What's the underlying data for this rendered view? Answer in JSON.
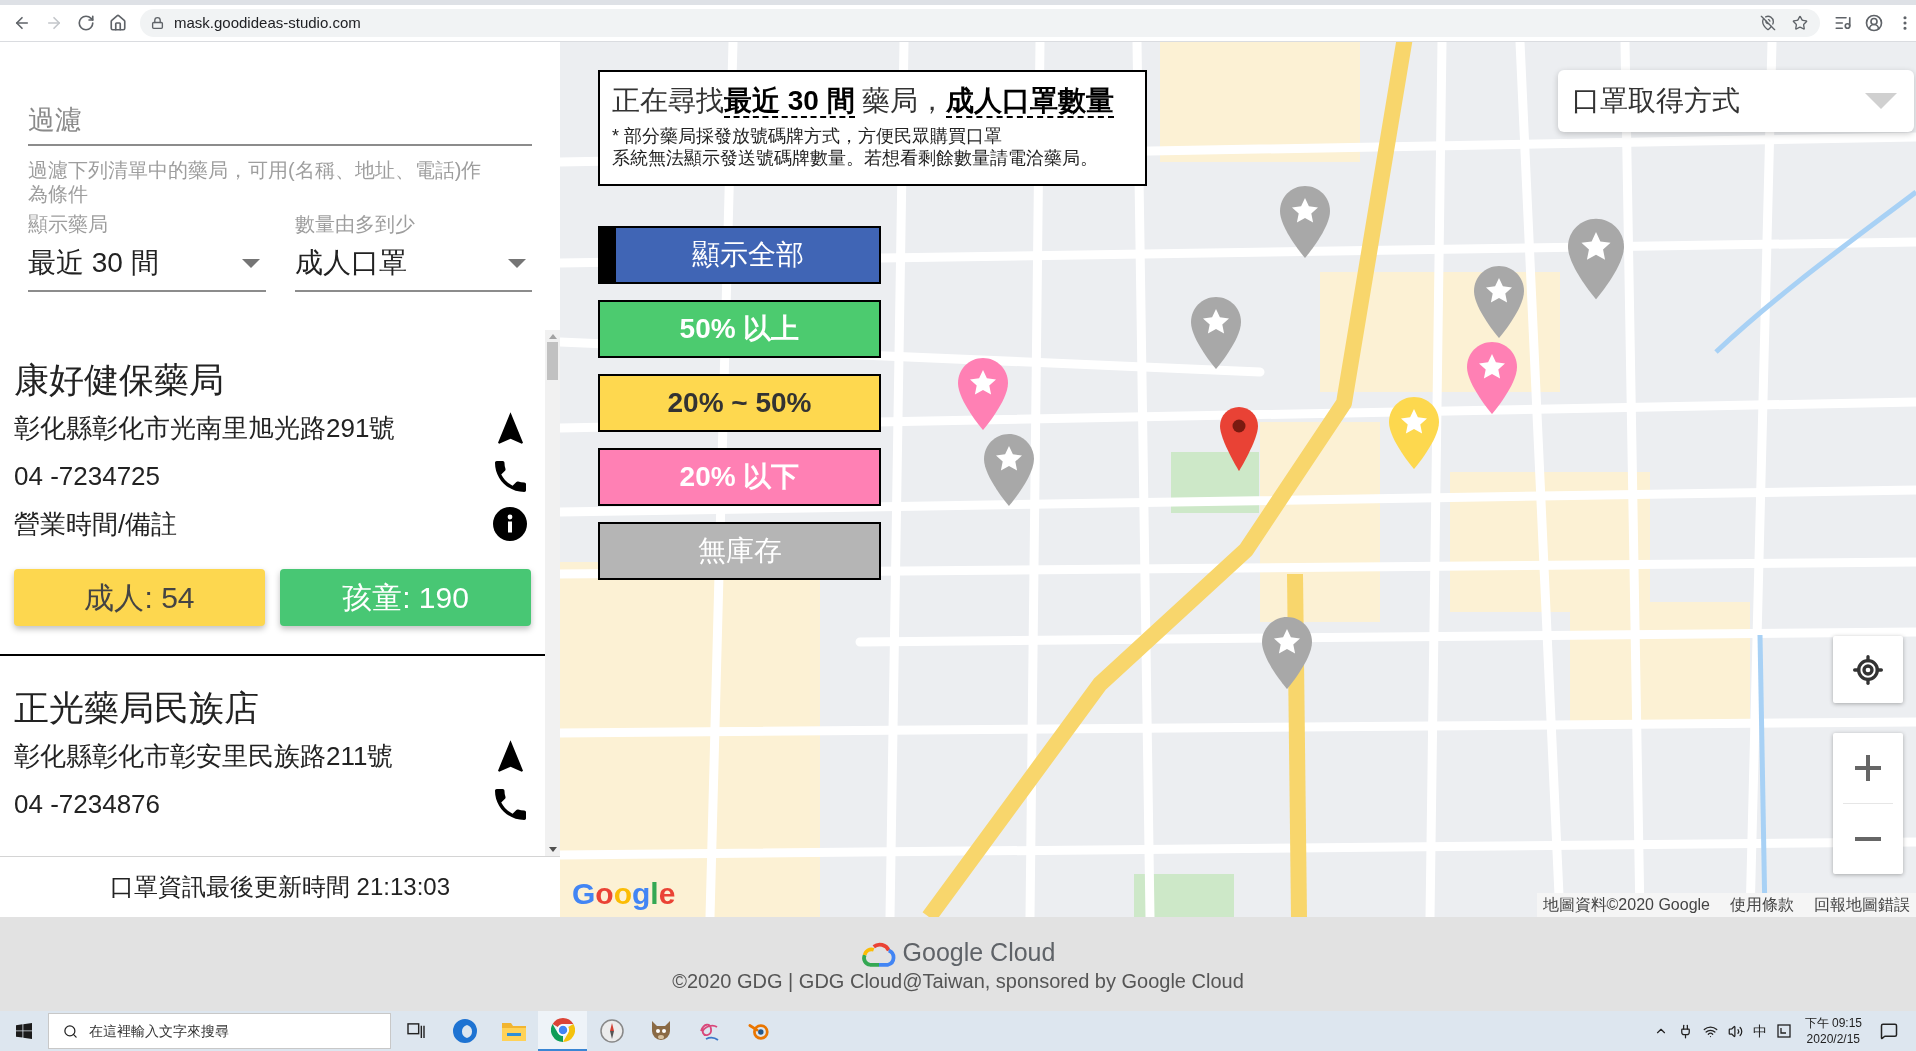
{
  "browser": {
    "nav": [
      {
        "kind": "back",
        "disabled": false
      },
      {
        "kind": "forward",
        "disabled": true
      },
      {
        "kind": "reload",
        "disabled": false
      },
      {
        "kind": "home",
        "disabled": false
      }
    ],
    "url": "mask.goodideas-studio.com",
    "omnibox_icons": [
      {
        "kind": "location-blocked"
      },
      {
        "kind": "bookmark"
      }
    ],
    "toolbar_icons": [
      {
        "kind": "media"
      },
      {
        "kind": "account"
      },
      {
        "kind": "menu"
      }
    ]
  },
  "sidebar": {
    "filter": {
      "placeholder": "過濾",
      "helper": "過濾下列清單中的藥局，可用(名稱、地址、電話)作為條件"
    },
    "selects": [
      {
        "label": "顯示藥局",
        "value": "最近 30 間"
      },
      {
        "label": "數量由多到少",
        "value": "成人口罩"
      }
    ],
    "pharmacies": [
      {
        "name": "康好健保藥局",
        "address": "彰化縣彰化市光南里旭光路291號",
        "phone": "04 -7234725",
        "note": "營業時間/備註",
        "stock": [
          {
            "label": "成人: 54",
            "color": "#fdd74f"
          },
          {
            "label": "孩童: 190",
            "color": "#48c774"
          }
        ]
      },
      {
        "name": "正光藥局民族店",
        "address": "彰化縣彰化市彰安里民族路211號",
        "phone": "04 -7234876"
      }
    ],
    "updated": "口罩資訊最後更新時間 21:13:03"
  },
  "map": {
    "summary": {
      "heading": [
        {
          "text": "正在尋找",
          "emphasis": false
        },
        {
          "text": "最近 30 間",
          "emphasis": true
        },
        {
          "text": " 藥局，",
          "emphasis": false
        },
        {
          "text": "成人口罩數量",
          "emphasis": true
        }
      ],
      "notes": [
        "* 部分藥局採發放號碼牌方式，方便民眾購買口罩",
        "系統無法顯示發送號碼牌數量。若想看剩餘數量請電洽藥局。"
      ]
    },
    "filters": [
      {
        "label": "顯示全部",
        "kind": "all",
        "color": "#4065b5",
        "selected": true
      },
      {
        "label": "50% 以上",
        "kind": "level",
        "color": "#4ccb6f",
        "selected": false
      },
      {
        "label": "20% ~ 50%",
        "kind": "level",
        "color": "#fed84f",
        "selected": false
      },
      {
        "label": "20% 以下",
        "kind": "level",
        "color": "#ff80b4",
        "selected": false
      },
      {
        "label": "無庫存",
        "kind": "empty",
        "color": "#b5b5b5",
        "selected": false
      }
    ],
    "pickup_select": {
      "placeholder": "口罩取得方式"
    },
    "markers": [
      {
        "kind": "pharmacy",
        "color": "#a8a8a8"
      },
      {
        "kind": "pharmacy",
        "color": "#a8a8a8"
      },
      {
        "kind": "pharmacy",
        "color": "#a8a8a8"
      },
      {
        "kind": "pharmacy",
        "color": "#a8a8a8"
      },
      {
        "kind": "pharmacy",
        "color": "#ff80b4"
      },
      {
        "kind": "pharmacy",
        "color": "#fdd84e"
      },
      {
        "kind": "location",
        "color": "#e94235"
      },
      {
        "kind": "pharmacy",
        "color": "#ff80b4"
      },
      {
        "kind": "pharmacy",
        "color": "#a8a8a8"
      },
      {
        "kind": "pharmacy",
        "color": "#a8a8a8"
      }
    ],
    "logo": "Google",
    "attribution": [
      "地圖資料©2020 Google",
      "使用條款",
      "回報地圖錯誤"
    ]
  },
  "footer": {
    "brand": "Google Cloud",
    "credit": "©2020 GDG | GDG Cloud@Taiwan, sponsored by Google Cloud"
  },
  "taskbar": {
    "search": {
      "placeholder": "在這裡輸入文字來搜尋"
    },
    "apps": [
      {
        "kind": "task-view",
        "selected": false
      },
      {
        "kind": "edge",
        "selected": false
      },
      {
        "kind": "files",
        "selected": false
      },
      {
        "kind": "chrome",
        "selected": true
      },
      {
        "kind": "compass",
        "selected": false
      },
      {
        "kind": "creature",
        "selected": false
      },
      {
        "kind": "scribble",
        "selected": false
      },
      {
        "kind": "blender",
        "selected": false
      }
    ],
    "tray": [
      {
        "kind": "chevron"
      },
      {
        "kind": "power"
      },
      {
        "kind": "wifi"
      },
      {
        "kind": "volume"
      },
      {
        "kind": "ime",
        "label": "中"
      },
      {
        "kind": "ime-mode"
      }
    ],
    "clock": {
      "time": "下午 09:15",
      "date": "2020/2/15"
    }
  }
}
